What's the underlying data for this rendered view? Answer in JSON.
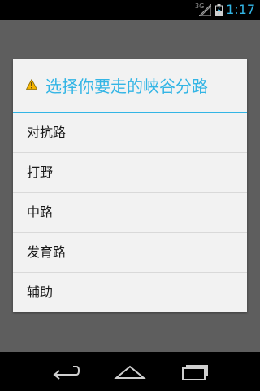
{
  "status_bar": {
    "network": "3G",
    "time": "1:17"
  },
  "dialog": {
    "title": "选择你要走的峡谷分路",
    "title_icon": "warning-icon",
    "items": [
      {
        "label": "对抗路"
      },
      {
        "label": "打野"
      },
      {
        "label": "中路"
      },
      {
        "label": "发育路"
      },
      {
        "label": "辅助"
      }
    ]
  },
  "nav_bar": {
    "buttons": [
      "back-icon",
      "home-icon",
      "recent-apps-icon"
    ]
  },
  "colors": {
    "accent": "#33b5e5",
    "dim_background": "#5e5e5e",
    "dialog_background": "#f2f2f2",
    "warning": "#f5b400"
  }
}
